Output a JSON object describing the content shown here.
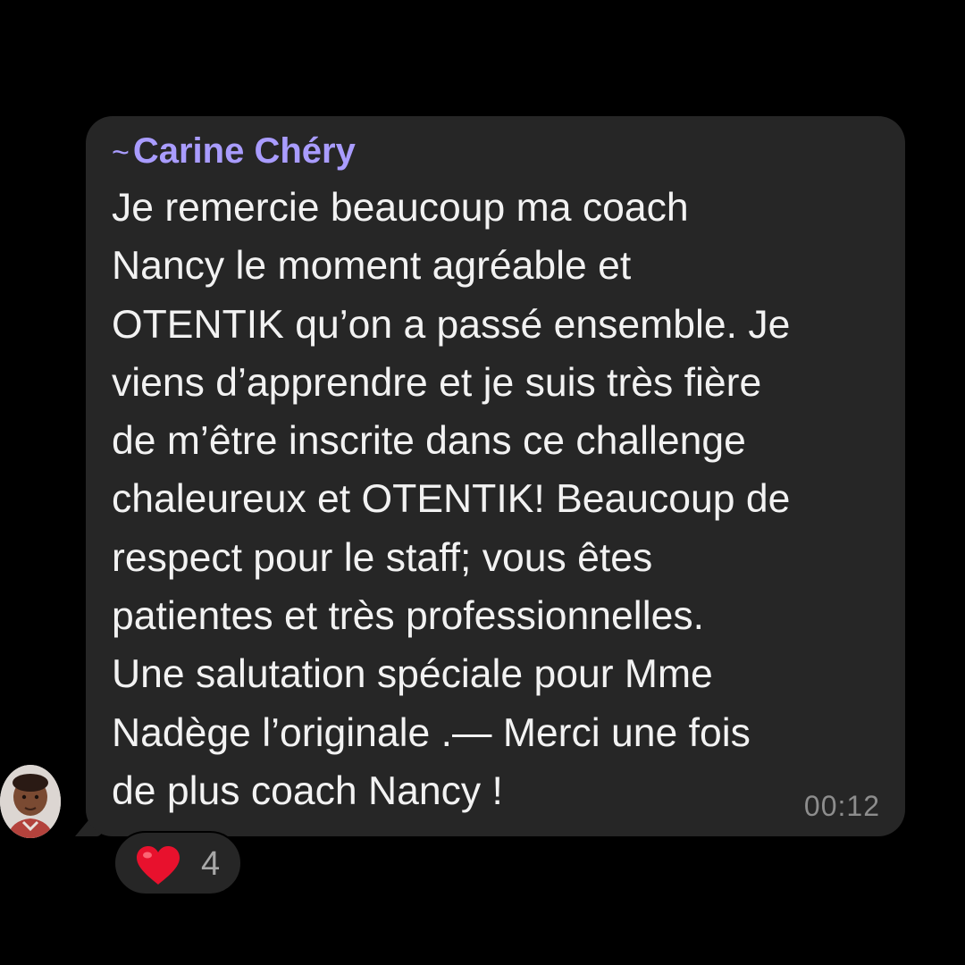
{
  "message": {
    "sender_prefix": "~",
    "sender_name": "Carine Chéry",
    "lines": [
      "Je remercie beaucoup ma coach",
      "Nancy le moment agréable et",
      "OTENTIK qu’on a passé ensemble. Je",
      "viens d’apprendre et je suis très fière",
      "de m’être inscrite dans ce challenge",
      "chaleureux et OTENTIK! Beaucoup de",
      "respect pour le staff; vous êtes",
      "patientes et très professionnelles.",
      "Une salutation spéciale pour Mme",
      "Nadège l’originale .—  Merci une fois",
      "de plus coach Nancy !"
    ],
    "time": "00:12"
  },
  "reaction": {
    "icon": "heart-icon",
    "count": "4"
  },
  "colors": {
    "background": "#000000",
    "bubble": "#262626",
    "sender": "#a99cff",
    "text": "#f2f2f2",
    "timestamp": "#8d8d8d",
    "heart": "#e8112d"
  }
}
